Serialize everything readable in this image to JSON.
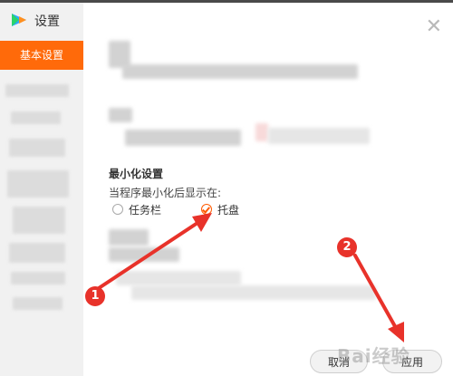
{
  "window": {
    "title": "设置"
  },
  "sidebar": {
    "active_label": "基本设置"
  },
  "minimize": {
    "section_title": "最小化设置",
    "description": "当程序最小化后显示在:",
    "options": [
      {
        "label": "任务栏",
        "checked": false
      },
      {
        "label": "托盘",
        "checked": true
      }
    ]
  },
  "buttons": {
    "cancel": "取消",
    "apply": "应用"
  },
  "annotations": {
    "step1": "1",
    "step2": "2"
  },
  "watermark": "Bai经验",
  "colors": {
    "accent": "#ff6a0a",
    "arrow": "#e8322a"
  }
}
